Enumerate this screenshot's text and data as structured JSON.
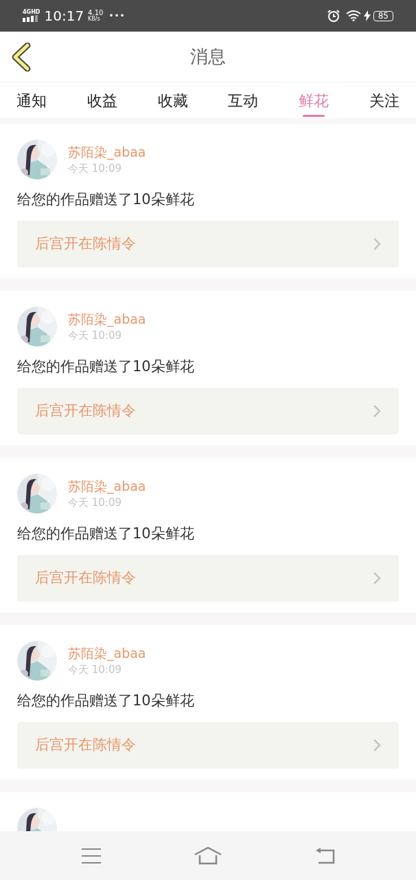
{
  "status_bar": {
    "network": "4GHD",
    "time": "10:17",
    "speed_value": "4.10",
    "speed_unit": "KB/s",
    "more": "•••",
    "battery": "85"
  },
  "header": {
    "title": "消息"
  },
  "tabs": [
    {
      "label": "通知",
      "selected": false
    },
    {
      "label": "收益",
      "selected": false
    },
    {
      "label": "收藏",
      "selected": false
    },
    {
      "label": "互动",
      "selected": false
    },
    {
      "label": "鲜花",
      "selected": true
    },
    {
      "label": "关注",
      "selected": false
    }
  ],
  "messages": [
    {
      "user": "苏陌染_abaa",
      "time": "今天 10:09",
      "text": "给您的作品赠送了10朵鲜花",
      "work": "后宫开在陈情令"
    },
    {
      "user": "苏陌染_abaa",
      "time": "今天 10:09",
      "text": "给您的作品赠送了10朵鲜花",
      "work": "后宫开在陈情令"
    },
    {
      "user": "苏陌染_abaa",
      "time": "今天 10:09",
      "text": "给您的作品赠送了10朵鲜花",
      "work": "后宫开在陈情令"
    },
    {
      "user": "苏陌染_abaa",
      "time": "今天 10:09",
      "text": "给您的作品赠送了10朵鲜花",
      "work": "后宫开在陈情令"
    }
  ]
}
